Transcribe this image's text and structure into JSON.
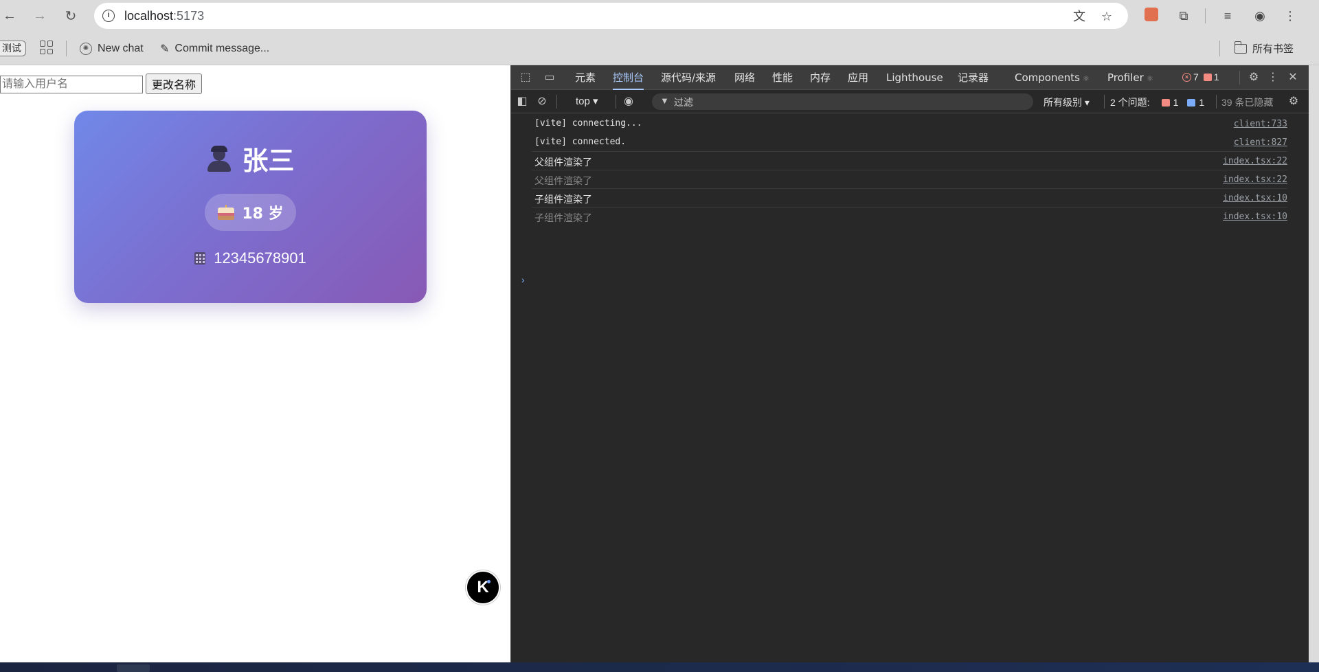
{
  "browser": {
    "url_host": "localhost",
    "url_port": ":5173",
    "icons": [
      "back-icon",
      "forward-icon",
      "reload-icon",
      "site-info-icon",
      "translate-icon",
      "star-icon",
      "extension-icon",
      "puzzle-icon",
      "media-icon",
      "profile-icon",
      "menu-icon"
    ]
  },
  "bookmarks": {
    "chip": "测试",
    "items": [
      {
        "label": "New chat",
        "icon": "chatgpt-icon"
      },
      {
        "label": "Commit message...",
        "icon": "brush-icon"
      }
    ],
    "all_label": "所有书签"
  },
  "page": {
    "input_placeholder": "请输入用户名",
    "button_label": "更改名称",
    "card": {
      "name": "张三",
      "age": "18 岁",
      "phone": "12345678901"
    }
  },
  "devtools": {
    "tabs": [
      "元素",
      "控制台",
      "源代码/来源",
      "网络",
      "性能",
      "内存",
      "应用",
      "Lighthouse",
      "记录器",
      "Components",
      "Profiler"
    ],
    "active_tab": "控制台",
    "errors": "7",
    "warnings": "1",
    "context": "top ▾",
    "filter_placeholder": "过滤",
    "level": "所有级别 ▾",
    "issues_label": "2 个问题:",
    "issues_warn": "1",
    "issues_info": "1",
    "hidden": "39 条已隐藏",
    "logs": [
      {
        "msg": "[vite] connecting...",
        "src": "client:733",
        "mono": true,
        "faded": false
      },
      {
        "msg": "[vite] connected.",
        "src": "client:827",
        "mono": true,
        "faded": false
      },
      {
        "msg": "父组件渲染了",
        "src": "index.tsx:22",
        "mono": false,
        "faded": false
      },
      {
        "msg": "父组件渲染了",
        "src": "index.tsx:22",
        "mono": false,
        "faded": true
      },
      {
        "msg": "子组件渲染了",
        "src": "index.tsx:10",
        "mono": false,
        "faded": false
      },
      {
        "msg": "子组件渲染了",
        "src": "index.tsx:10",
        "mono": false,
        "faded": true
      }
    ]
  }
}
